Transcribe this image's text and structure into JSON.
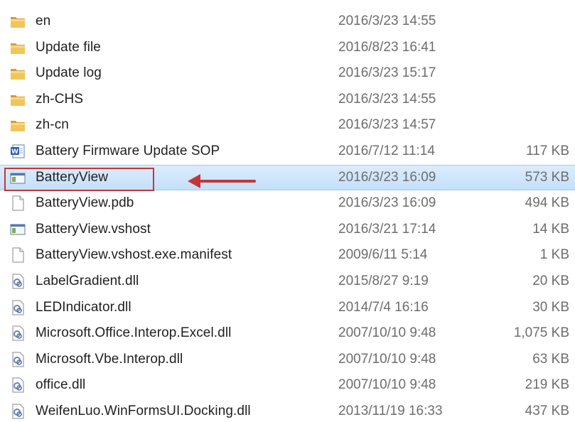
{
  "files": [
    {
      "name": "en",
      "date": "2016/3/23 14:55",
      "size": "",
      "icon": "folder-icon"
    },
    {
      "name": "Update file",
      "date": "2016/8/23 16:41",
      "size": "",
      "icon": "folder-icon"
    },
    {
      "name": "Update log",
      "date": "2016/3/23 15:17",
      "size": "",
      "icon": "folder-icon"
    },
    {
      "name": "zh-CHS",
      "date": "2016/3/23 14:55",
      "size": "",
      "icon": "folder-icon"
    },
    {
      "name": "zh-cn",
      "date": "2016/3/23 14:57",
      "size": "",
      "icon": "folder-icon"
    },
    {
      "name": "Battery Firmware Update SOP",
      "date": "2016/7/12 11:14",
      "size": "117 KB",
      "icon": "word-document-icon"
    },
    {
      "name": "BatteryView",
      "date": "2016/3/23 16:09",
      "size": "573 KB",
      "icon": "application-icon",
      "selected": true
    },
    {
      "name": "BatteryView.pdb",
      "date": "2016/3/23 16:09",
      "size": "494 KB",
      "icon": "blank-file-icon"
    },
    {
      "name": "BatteryView.vshost",
      "date": "2016/3/21 17:14",
      "size": "14 KB",
      "icon": "application-icon"
    },
    {
      "name": "BatteryView.vshost.exe.manifest",
      "date": "2009/6/11 5:14",
      "size": "1 KB",
      "icon": "blank-file-icon"
    },
    {
      "name": "LabelGradient.dll",
      "date": "2015/8/27 9:19",
      "size": "20 KB",
      "icon": "dll-icon"
    },
    {
      "name": "LEDIndicator.dll",
      "date": "2014/7/4 16:16",
      "size": "30 KB",
      "icon": "dll-icon"
    },
    {
      "name": "Microsoft.Office.Interop.Excel.dll",
      "date": "2007/10/10 9:48",
      "size": "1,075 KB",
      "icon": "dll-icon"
    },
    {
      "name": "Microsoft.Vbe.Interop.dll",
      "date": "2007/10/10 9:48",
      "size": "63 KB",
      "icon": "dll-icon"
    },
    {
      "name": "office.dll",
      "date": "2007/10/10 9:48",
      "size": "219 KB",
      "icon": "dll-icon"
    },
    {
      "name": "WeifenLuo.WinFormsUI.Docking.dll",
      "date": "2013/11/19 16:33",
      "size": "437 KB",
      "icon": "dll-icon"
    }
  ],
  "annotation": {
    "highlight_color": "#c2373a",
    "arrow_color": "#c2373a",
    "target": "BatteryView"
  },
  "colors": {
    "selected_row": "#cfe6fc",
    "folder": "#e9b84a",
    "meta_text": "#6d6d6d"
  }
}
